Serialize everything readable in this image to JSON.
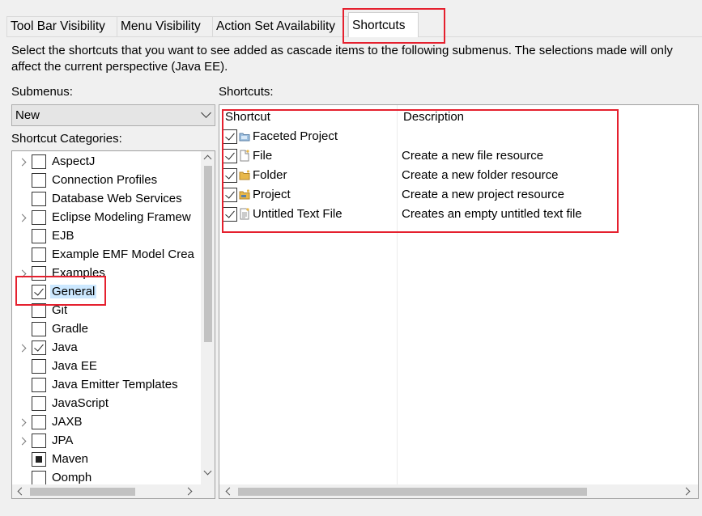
{
  "tabs": [
    {
      "label": "Tool Bar Visibility"
    },
    {
      "label": "Menu Visibility"
    },
    {
      "label": "Action Set Availability"
    },
    {
      "label": "Shortcuts",
      "active": true
    }
  ],
  "description": "Select the shortcuts that you want to see added as cascade items to the following submenus.  The selections made will only affect the current perspective (Java EE).",
  "submenus": {
    "label": "Submenus:",
    "selected": "New"
  },
  "categories_label": "Shortcut Categories:",
  "categories": [
    {
      "label": "AspectJ",
      "expandable": true,
      "state": "unchecked"
    },
    {
      "label": "Connection Profiles",
      "expandable": false,
      "state": "unchecked"
    },
    {
      "label": "Database Web Services",
      "expandable": false,
      "state": "unchecked"
    },
    {
      "label": "Eclipse Modeling Framew",
      "expandable": true,
      "state": "unchecked"
    },
    {
      "label": "EJB",
      "expandable": false,
      "state": "unchecked"
    },
    {
      "label": "Example EMF Model Crea",
      "expandable": false,
      "state": "unchecked"
    },
    {
      "label": "Examples",
      "expandable": true,
      "state": "unchecked"
    },
    {
      "label": "General",
      "expandable": false,
      "state": "checked",
      "selected": true
    },
    {
      "label": "Git",
      "expandable": false,
      "state": "unchecked"
    },
    {
      "label": "Gradle",
      "expandable": false,
      "state": "unchecked"
    },
    {
      "label": "Java",
      "expandable": true,
      "state": "checked"
    },
    {
      "label": "Java EE",
      "expandable": false,
      "state": "unchecked"
    },
    {
      "label": "Java Emitter Templates",
      "expandable": false,
      "state": "unchecked"
    },
    {
      "label": "JavaScript",
      "expandable": false,
      "state": "unchecked"
    },
    {
      "label": "JAXB",
      "expandable": true,
      "state": "unchecked"
    },
    {
      "label": "JPA",
      "expandable": true,
      "state": "unchecked"
    },
    {
      "label": "Maven",
      "expandable": false,
      "state": "partial"
    },
    {
      "label": "Oomph",
      "expandable": false,
      "state": "unchecked"
    }
  ],
  "shortcuts_label": "Shortcuts:",
  "shortcuts_table": {
    "columns": [
      "Shortcut",
      "Description"
    ],
    "rows": [
      {
        "name": "Faceted Project",
        "description": "",
        "icon": "faceted-project-icon",
        "checked": true
      },
      {
        "name": "File",
        "description": "Create a new file resource",
        "icon": "file-icon",
        "checked": true
      },
      {
        "name": "Folder",
        "description": "Create a new folder resource",
        "icon": "folder-icon",
        "checked": true
      },
      {
        "name": "Project",
        "description": "Create a new project resource",
        "icon": "project-icon",
        "checked": true
      },
      {
        "name": "Untitled Text File",
        "description": "Creates an empty untitled text file",
        "icon": "text-file-icon",
        "checked": true
      }
    ]
  },
  "colors": {
    "highlight": "#e5202e",
    "selection": "#cce8ff",
    "folder": "#e8b84a"
  }
}
